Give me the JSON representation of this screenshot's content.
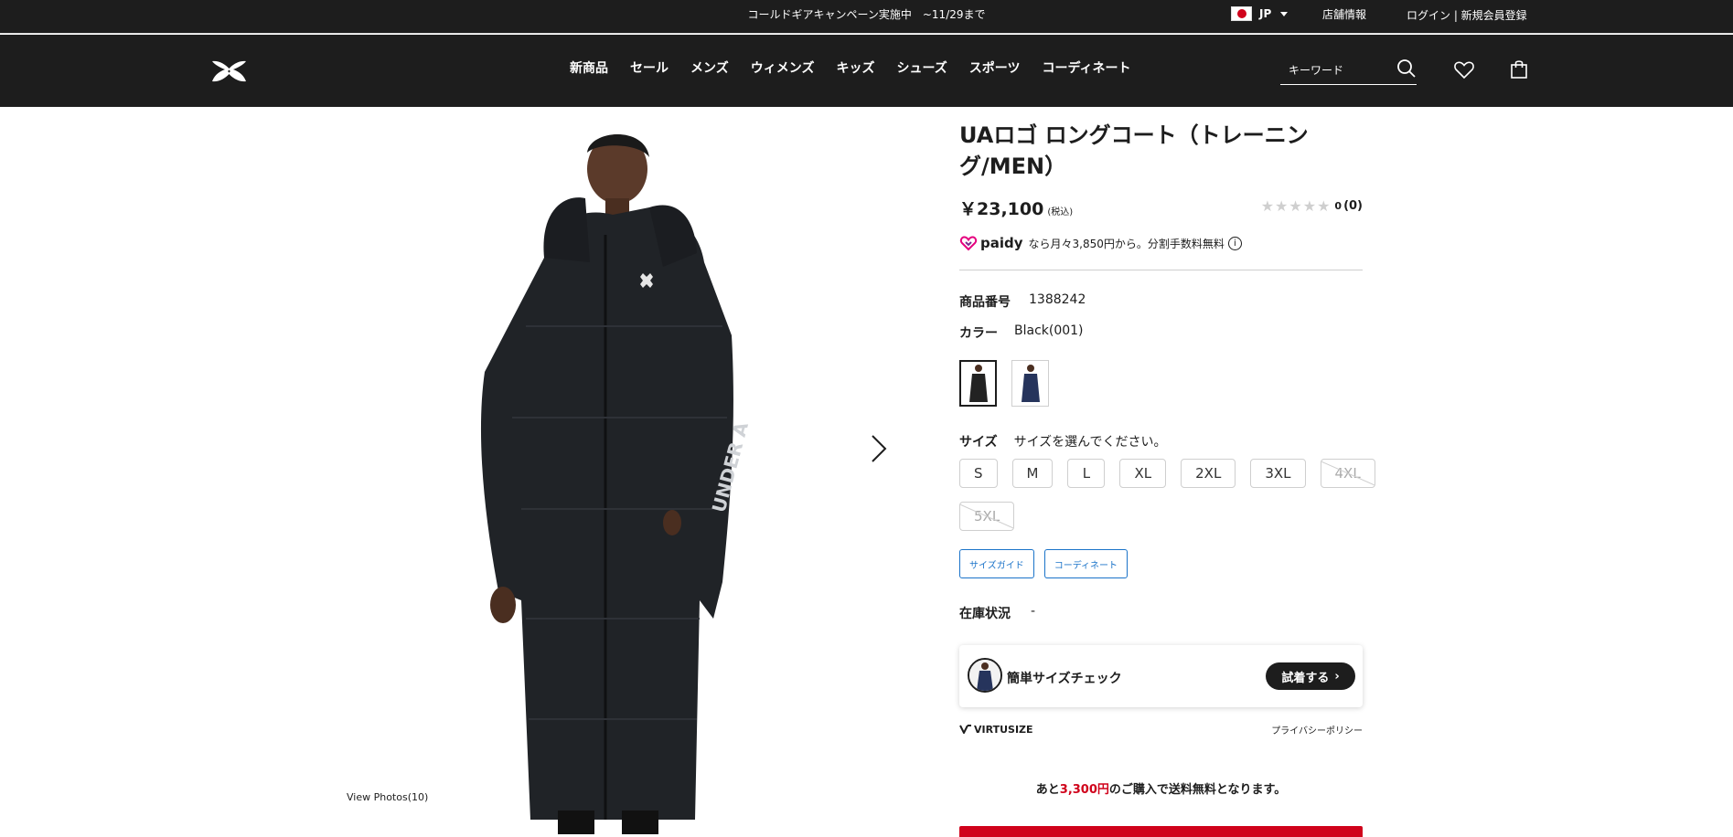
{
  "topbar": {
    "campaign": "コールドギアキャンペーン実施中　~11/29まで",
    "language": "JP",
    "store_info": "店舗情報",
    "login": "ログイン | 新規会員登録"
  },
  "header": {
    "nav": [
      "新商品",
      "セール",
      "メンズ",
      "ウィメンズ",
      "キッズ",
      "シューズ",
      "スポーツ",
      "コーディネート"
    ],
    "search_placeholder": "キーワード"
  },
  "gallery": {
    "view_photos": "View Photos(10)"
  },
  "product": {
    "title": "UAロゴ ロングコート（トレーニング/MEN）",
    "price": "￥23,100",
    "tax_note": "(税込)",
    "rating_value": "0",
    "review_count": "(0)",
    "paidy_brand": "paidy",
    "paidy_text": "なら月々3,850円から。分割手数料無料",
    "product_no_label": "商品番号",
    "product_no": "1388242",
    "color_label": "カラー",
    "color_value": "Black(001)",
    "size_label": "サイズ",
    "size_prompt": "サイズを選んでください。",
    "sizes": [
      {
        "label": "S",
        "available": true
      },
      {
        "label": "M",
        "available": true
      },
      {
        "label": "L",
        "available": true
      },
      {
        "label": "XL",
        "available": true
      },
      {
        "label": "2XL",
        "available": true
      },
      {
        "label": "3XL",
        "available": true
      },
      {
        "label": "4XL",
        "available": false
      },
      {
        "label": "5XL",
        "available": false
      }
    ],
    "size_guide": "サイズガイド",
    "coordinate": "コーディネート",
    "stock_label": "在庫状況",
    "stock_value": "-"
  },
  "virtusize": {
    "title": "簡単サイズチェック",
    "button": "試着する",
    "brand": "VIRTUSIZE",
    "privacy": "プライバシーポリシー"
  },
  "shipping": {
    "prefix": "あと",
    "amount": "3,300円",
    "suffix": "のご購入で送料無料となります。"
  },
  "colors": {
    "dark": "#1d1d1d",
    "accent_red": "#d0021b",
    "link_blue": "#1a73c9"
  }
}
